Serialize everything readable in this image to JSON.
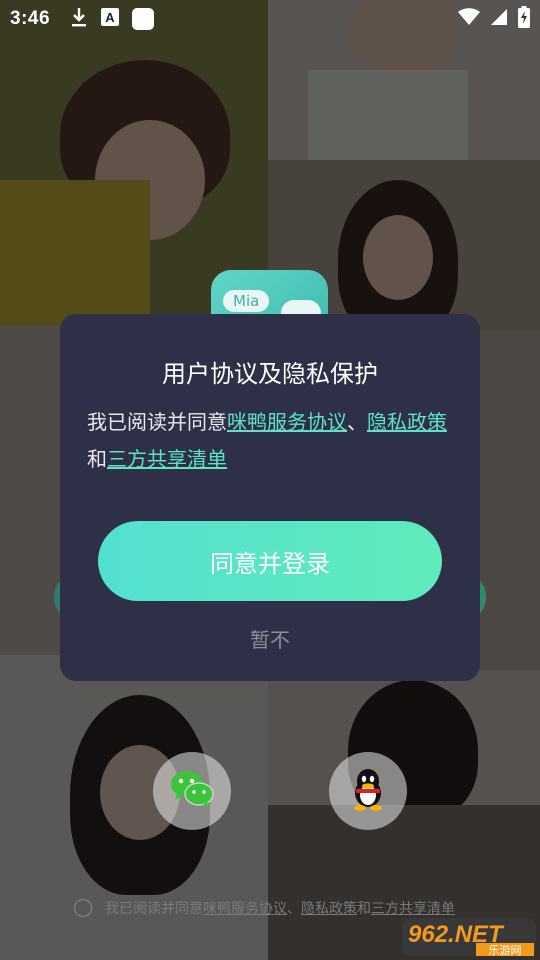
{
  "status_bar": {
    "time": "3:46",
    "icons": [
      "download-icon",
      "text-a-icon",
      "app-square-icon",
      "wifi-icon",
      "signal-icon",
      "battery-icon"
    ]
  },
  "app_logo": {
    "text": "Mia"
  },
  "dialog": {
    "title": "用户协议及隐私保护",
    "body_prefix": "我已阅读并同意",
    "link_service": "咪鸭服务协议",
    "sep": "、",
    "link_privacy": "隐私政策",
    "and": "和",
    "link_share": "三方共享清单",
    "agree_button": "同意并登录",
    "later_button": "暂不"
  },
  "social_login": {
    "wechat_icon": "wechat-icon",
    "qq_icon": "qq-icon"
  },
  "bottom_agreement": {
    "prefix": "我已阅读并同意",
    "link_service": "咪鸭服务协议",
    "sep": "、",
    "link_privacy": "隐私政策",
    "and": "和",
    "link_share": "三方共享清单"
  },
  "watermark": {
    "main": "962.NET",
    "sub": "乐游网"
  },
  "colors": {
    "dialog_bg": "#2e3047",
    "accent": "#5fe3c7",
    "button_gradient_start": "#53e0d0",
    "button_gradient_end": "#60ebbb"
  }
}
